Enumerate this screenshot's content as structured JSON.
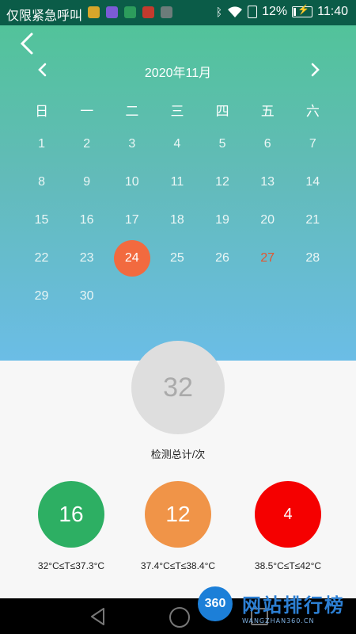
{
  "status_bar": {
    "carrier": "仅限紧急呼叫",
    "battery_percent": "12%",
    "time": "11:40",
    "icons": [
      "bluetooth-icon",
      "wifi-icon",
      "sim-icon",
      "battery-charging-icon"
    ]
  },
  "calendar": {
    "month_title": "2020年11月",
    "weekdays": [
      "日",
      "一",
      "二",
      "三",
      "四",
      "五",
      "六"
    ],
    "weeks": [
      [
        "1",
        "2",
        "3",
        "4",
        "5",
        "6",
        "7"
      ],
      [
        "8",
        "9",
        "10",
        "11",
        "12",
        "13",
        "14"
      ],
      [
        "15",
        "16",
        "17",
        "18",
        "19",
        "20",
        "21"
      ],
      [
        "22",
        "23",
        "24",
        "25",
        "26",
        "27",
        "28"
      ],
      [
        "29",
        "30",
        "",
        "",
        "",
        "",
        ""
      ]
    ],
    "selected_day": "24",
    "highlight_day": "27",
    "colors": {
      "selected": "#f26a3f",
      "highlight": "#e4552f"
    }
  },
  "summary": {
    "total": "32",
    "total_label": "检测总计/次"
  },
  "stats": [
    {
      "count": "16",
      "range": "32°C≤T≤37.3°C",
      "color": "#2daf63"
    },
    {
      "count": "12",
      "range": "37.4°C≤T≤38.4°C",
      "color": "#f09448"
    },
    {
      "count": "4",
      "range": "38.5°C≤T≤42°C",
      "color": "#f50000"
    }
  ],
  "watermark": {
    "logo": "360",
    "title": "网站排行榜",
    "subtitle": "WANGZHAN360.CN"
  }
}
